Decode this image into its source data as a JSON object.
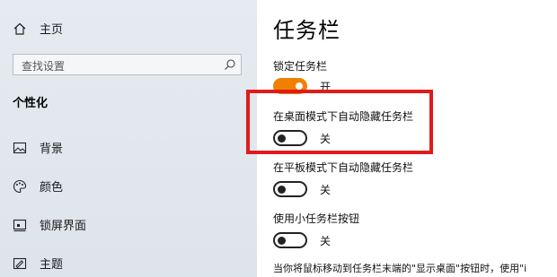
{
  "sidebar": {
    "home_label": "主页",
    "search_placeholder": "查找设置",
    "section_heading": "个性化",
    "items": [
      {
        "label": "背景",
        "icon": "image-icon"
      },
      {
        "label": "颜色",
        "icon": "palette-icon"
      },
      {
        "label": "锁屏界面",
        "icon": "lock-screen-icon"
      },
      {
        "label": "主题",
        "icon": "theme-icon"
      }
    ]
  },
  "main": {
    "title": "任务栏",
    "settings": [
      {
        "label": "锁定任务栏",
        "state": "开",
        "on": true
      },
      {
        "label": "在桌面模式下自动隐藏任务栏",
        "state": "关",
        "on": false
      },
      {
        "label": "在平板模式下自动隐藏任务栏",
        "state": "关",
        "on": false
      },
      {
        "label": "使用小任务栏按钮",
        "state": "关",
        "on": false
      }
    ],
    "footer": "当你将鼠标移动到任务栏末端的\"显示桌面\"按钮时，使用\"i"
  },
  "colors": {
    "accent": "#f08100",
    "highlight": "#e01b1b",
    "sidebar_bg": "#e6ebf0"
  }
}
